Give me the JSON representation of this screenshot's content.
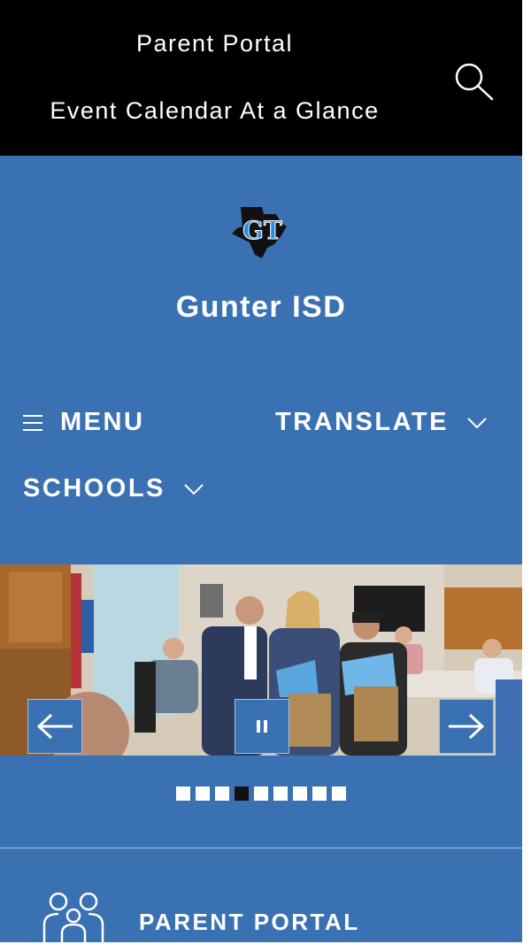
{
  "top_links": [
    "Parent Portal",
    "Event Calendar At a Glance"
  ],
  "site": {
    "name": "Gunter ISD",
    "logo_alt": "GT"
  },
  "nav": {
    "menu": "MENU",
    "translate": "TRANSLATE",
    "schools": "SCHOOLS"
  },
  "icons": {
    "search": "search-icon",
    "menu": "hamburger-icon",
    "chevron": "chevron-down-icon",
    "prev": "arrow-left-icon",
    "pause": "pause-icon",
    "next": "arrow-right-icon",
    "parents": "family-icon"
  },
  "slideshow": {
    "slide_count": 9,
    "active_index": 3
  },
  "quick_links": [
    {
      "label": "PARENT PORTAL"
    }
  ],
  "colors": {
    "brand_blue": "#3a71b3",
    "top_bar": "#000000"
  }
}
